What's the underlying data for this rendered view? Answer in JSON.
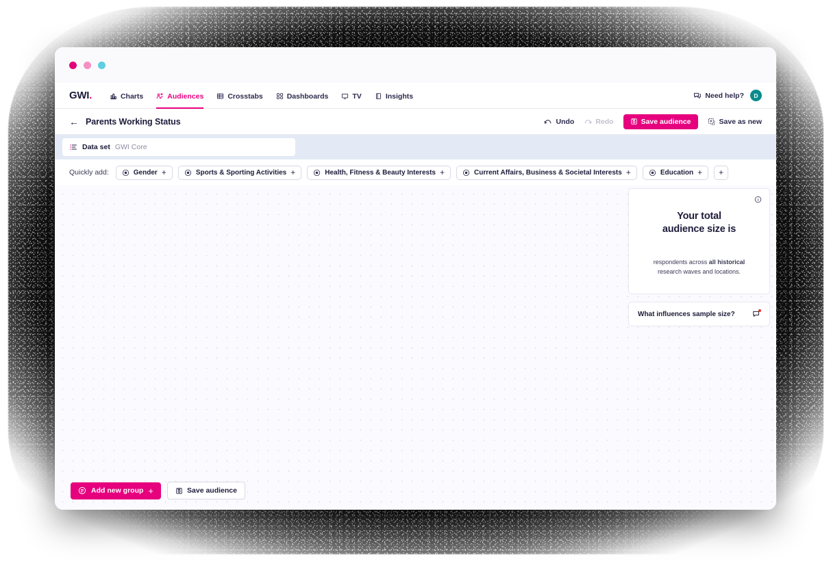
{
  "window": {
    "dots": [
      {
        "name": "close-dot",
        "color": "#e1007a"
      },
      {
        "name": "minimize-dot",
        "color": "#f58fc2"
      },
      {
        "name": "maximize-dot",
        "color": "#5ecfe0"
      }
    ]
  },
  "nav": {
    "logo": "GWI",
    "logo_dot": ".",
    "items": [
      {
        "label": "Charts",
        "icon": "bar-chart-icon",
        "active": false
      },
      {
        "label": "Audiences",
        "icon": "audiences-people-icon",
        "active": true
      },
      {
        "label": "Crosstabs",
        "icon": "crosstabs-grid-icon",
        "active": false
      },
      {
        "label": "Dashboards",
        "icon": "dashboards-squares-icon",
        "active": false
      },
      {
        "label": "TV",
        "icon": "tv-monitor-icon",
        "active": false
      },
      {
        "label": "Insights",
        "icon": "insights-book-icon",
        "active": false
      }
    ],
    "help_label": "Need help?",
    "help_icon": "chat-bubbles-icon",
    "avatar_initial": "D",
    "avatar_color": "#0b8c8c"
  },
  "toolbar": {
    "back_icon": "back-arrow-icon",
    "title": "Parents Working Status",
    "undo_label": "Undo",
    "redo_label": "Redo",
    "save_audience_label": "Save audience",
    "save_as_new_label": "Save as new",
    "accent_color": "#e6007e"
  },
  "dataset": {
    "icon": "dataset-list-icon",
    "label": "Data set",
    "value": "GWI Core",
    "band_color": "#e3eaf5"
  },
  "quick_add": {
    "label": "Quickly add:",
    "chips": [
      {
        "label": "Gender",
        "icon": "target-circle-icon"
      },
      {
        "label": "Sports & Sporting Activities",
        "icon": "target-circle-icon"
      },
      {
        "label": "Health, Fitness & Beauty Interests",
        "icon": "target-circle-icon"
      },
      {
        "label": "Current Affairs, Business & Societal Interests",
        "icon": "target-circle-icon"
      },
      {
        "label": "Education",
        "icon": "target-circle-icon"
      }
    ],
    "add_more_label": "+"
  },
  "audience_size_card": {
    "info_icon": "info-circle-icon",
    "heading_line1": "Your total",
    "heading_line2": "audience size is",
    "value": "",
    "subtitle_prefix": "respondents across ",
    "subtitle_bold": "all historical",
    "subtitle_suffix": "research waves and locations."
  },
  "sample_card": {
    "label": "What influences sample size?",
    "icon": "chat-help-icon",
    "badge_color": "#e8342a"
  },
  "bottom_bar": {
    "add_group_label": "Add new group",
    "add_group_icon": "group-circle-icon",
    "add_group_plus": "+",
    "save_audience_label": "Save audience",
    "save_icon": "save-disk-icon"
  }
}
